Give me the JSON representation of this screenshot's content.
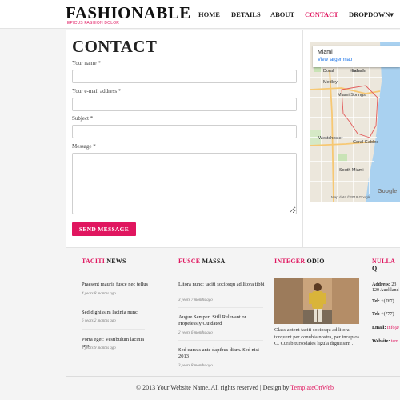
{
  "header": {
    "logo": "FASHIONABLE",
    "tagline": "EPICUS FASHION DOLOR",
    "nav": [
      {
        "label": "HOME"
      },
      {
        "label": "DETAILS"
      },
      {
        "label": "ABOUT"
      },
      {
        "label": "CONTACT",
        "active": true
      },
      {
        "label": "DROPDOWN▾"
      }
    ]
  },
  "contact": {
    "title": "CONTACT",
    "name_label": "Your name *",
    "email_label": "Your e-mail address *",
    "subject_label": "Subject *",
    "message_label": "Message *",
    "name_value": "",
    "email_value": "",
    "subject_value": "",
    "message_value": "",
    "send_label": "SEND MESSAGE"
  },
  "map": {
    "city": "Miami",
    "larger_link": "View larger map",
    "places": [
      "Hialeah",
      "Miami Springs",
      "Westchester",
      "Coral Gables",
      "South Miami",
      "Medley",
      "Doral"
    ],
    "footer": "Map data ©2019 Google",
    "brand": "Google"
  },
  "columns": [
    {
      "accent": "TACITI",
      "title": "NEWS",
      "items": [
        {
          "text": "Praesent mauris fusce nec tellus",
          "meta": "4 years 8 months ago"
        },
        {
          "text": "Sed dignissim lacinia nunc",
          "meta": "6 years 2 months ago"
        },
        {
          "text": "Porta eget: Vestibulum lacinia arcu",
          "meta": "3 years 9 months ago"
        }
      ]
    },
    {
      "accent": "FUSCE",
      "title": "MASSA",
      "items": [
        {
          "text": "Litora nunc: taciti sociosqu ad litora tibbi",
          "meta": "3 years 7 months ago"
        },
        {
          "text": "Augue Semper: Still Relevant or Hopelessly Outdated",
          "meta": "2 years 6 months ago"
        },
        {
          "text": "Sed cursus ante dapibus diam. Sed nisi 2013",
          "meta": "3 years 8 months ago"
        }
      ]
    },
    {
      "accent": "INTEGER",
      "title": "ODIO",
      "paragraph": "Class aptent taciti sociosqu ad litora torquent per conubia nostra, per inceptos C. Curabitursodales ligula dignissim ."
    },
    {
      "accent": "NULLA",
      "title": "Q",
      "address_label": "Address:",
      "address_value": "23",
      "address_line2": "120 Auckland",
      "tel1_label": "Tel:",
      "tel1_value": "+(767)",
      "tel2_label": "Tel:",
      "tel2_value": "+(777)",
      "email_label": "Email:",
      "email_value": "info@",
      "website_label": "Website:",
      "website_value": "tem"
    }
  ],
  "footer": {
    "copyright": "© 2013 Your Website Name. All rights reserved | Design by ",
    "designer": "TemplateOnWeb"
  },
  "colors": {
    "accent": "#e0165f",
    "background": "#f4f4f4"
  }
}
